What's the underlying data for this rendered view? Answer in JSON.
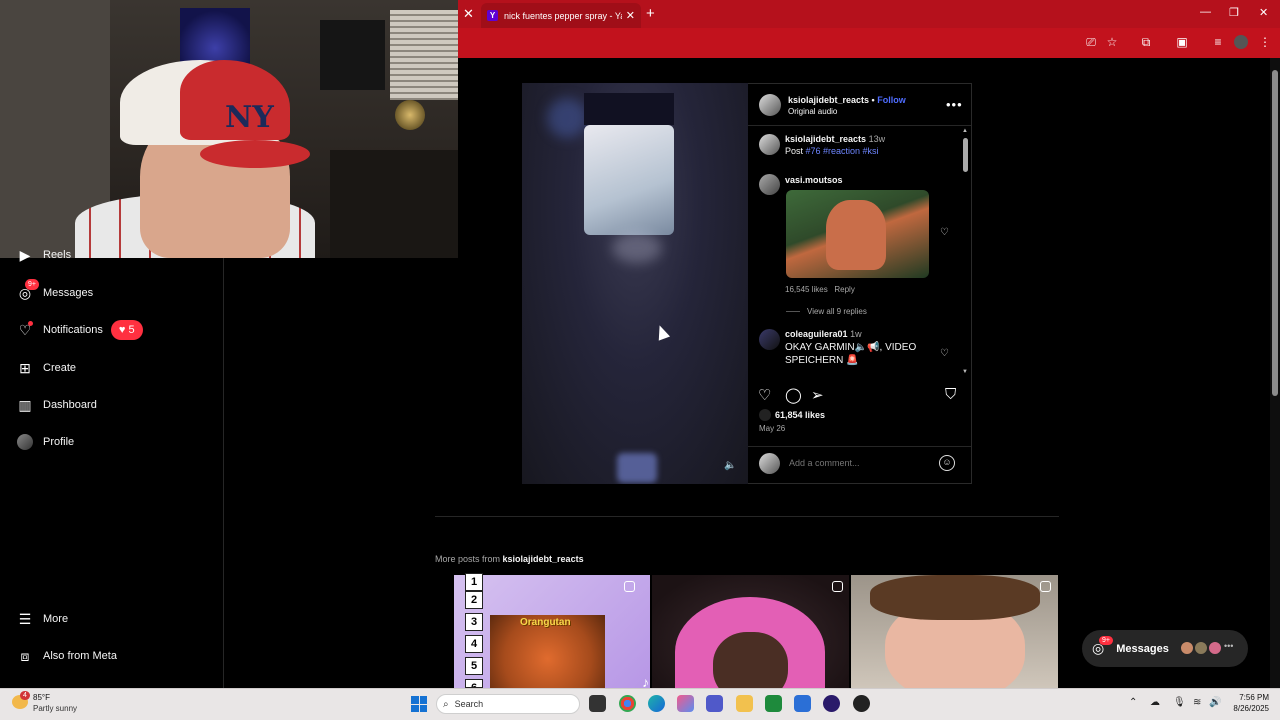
{
  "browser": {
    "tab_title": "nick fuentes pepper spray - Yah",
    "tab_favicon": "Y",
    "accent": "#b5111c"
  },
  "sidebar": {
    "items": [
      {
        "label": "Reels",
        "icon": "reels-icon"
      },
      {
        "label": "Messages",
        "icon": "messenger-icon",
        "badge": "9+"
      },
      {
        "label": "Notifications",
        "icon": "heart-icon",
        "pill_count": "5"
      },
      {
        "label": "Create",
        "icon": "plus-square-icon"
      },
      {
        "label": "Dashboard",
        "icon": "dashboard-icon"
      },
      {
        "label": "Profile",
        "icon": "avatar"
      },
      {
        "label": "More",
        "icon": "hamburger-icon"
      },
      {
        "label": "Also from Meta",
        "icon": "meta-icon"
      }
    ]
  },
  "post": {
    "username": "ksiolajidebt_reacts",
    "follow_sep": " • ",
    "follow": "Follow",
    "audio": "Original audio",
    "caption_user": "ksiolajidebt_reacts",
    "caption_time": "13w",
    "caption_prefix": "Post ",
    "caption_tags": "#76 #reaction #ksi",
    "comments": [
      {
        "user": "vasi.moutsos",
        "likes": "16,545 likes",
        "reply": "Reply",
        "view_replies": "View all 9 replies"
      },
      {
        "user": "coleaguilera01",
        "time": "1w",
        "text1": "OKAY GARMIN🔈📢, VIDEO",
        "text2": "SPEICHERN 🚨"
      }
    ],
    "likes": "61,854 likes",
    "date": "May 26",
    "add_comment_placeholder": "Add a comment..."
  },
  "more_posts": {
    "prefix": "More posts from ",
    "user": "ksiolajidebt_reacts",
    "thumb1_numbers": [
      "1",
      "2",
      "3",
      "4",
      "5",
      "6"
    ],
    "thumb1_label": "Orangutan"
  },
  "messages_float": {
    "label": "Messages",
    "badge": "9+"
  },
  "taskbar": {
    "weather_temp": "85°F",
    "weather_desc": "Partly sunny",
    "weather_badge": "4",
    "search_placeholder": "Search",
    "time": "7:56 PM",
    "date": "8/26/2025"
  }
}
